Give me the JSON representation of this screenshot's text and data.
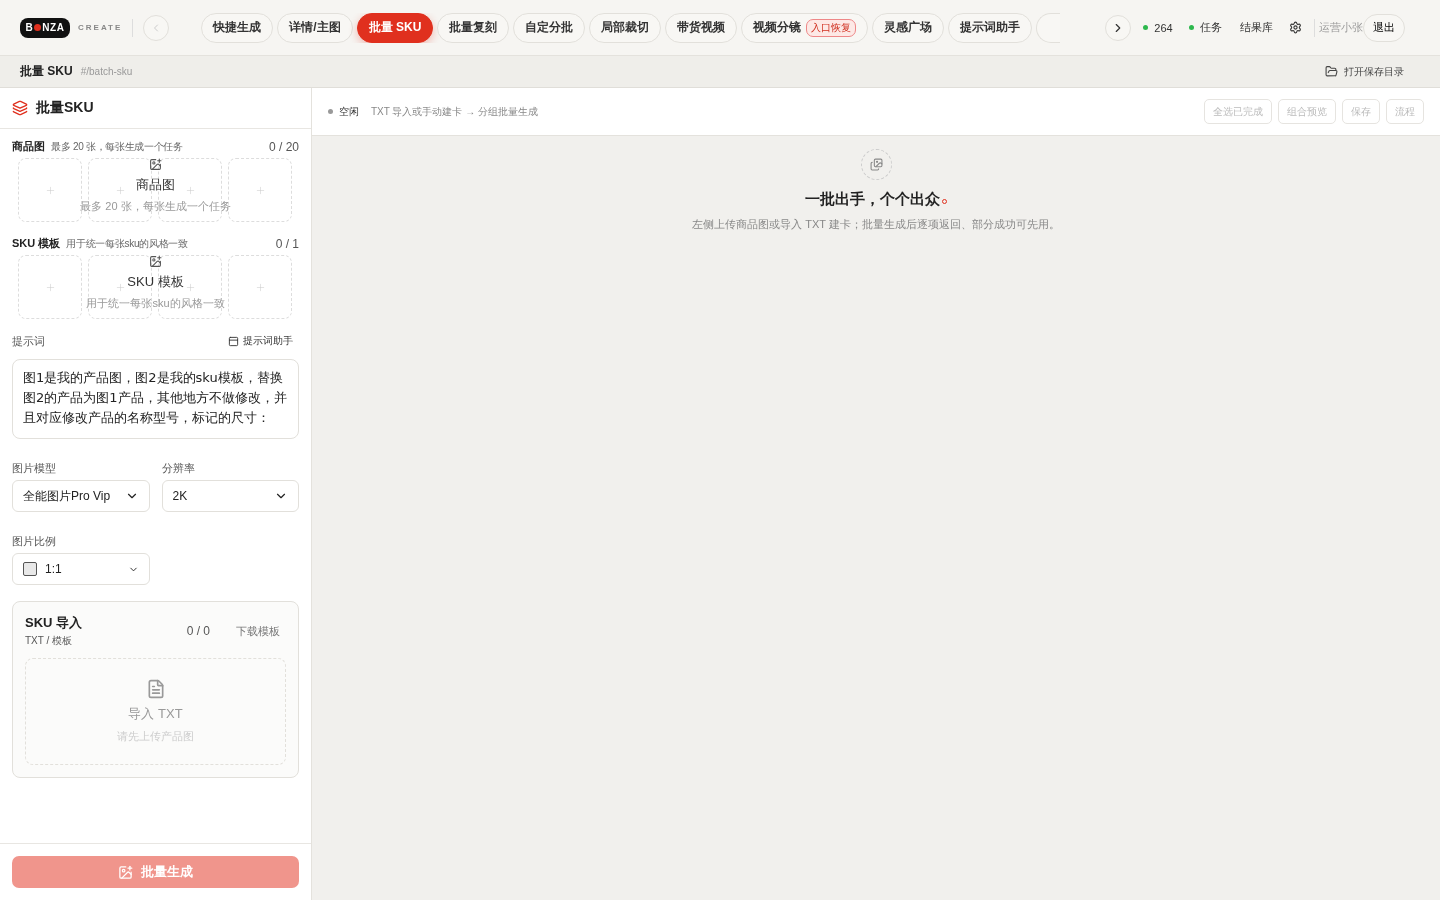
{
  "logo": {
    "left": "B",
    "right": "NZA",
    "tag": "CREATE"
  },
  "tabs": [
    {
      "label": "快捷生成",
      "selected": false
    },
    {
      "label": "详情/主图",
      "selected": false
    },
    {
      "label": "批量 SKU",
      "selected": true
    },
    {
      "label": "批量复刻",
      "selected": false
    },
    {
      "label": "自定分批",
      "selected": false
    },
    {
      "label": "局部裁切",
      "selected": false
    },
    {
      "label": "带货视频",
      "selected": false
    },
    {
      "label": "视频分镜",
      "selected": false,
      "badge": "入口恢复"
    },
    {
      "label": "灵感广场",
      "selected": false
    },
    {
      "label": "提示词助手",
      "selected": false
    }
  ],
  "top_right": {
    "credits": "264",
    "tasks": "任务",
    "results": "结果库",
    "user": "运营小张",
    "logout": "退出"
  },
  "breadcrumb": {
    "title": "批量 SKU",
    "path": "#/batch-sku",
    "open_folder": "打开保存目录"
  },
  "panel": {
    "title": "批量SKU",
    "uploads": [
      {
        "label": "商品图",
        "hint": "最多 20 张，每张生成一个任务",
        "count": "0 / 20",
        "overlay_label": "商品图",
        "overlay_hint": "最多 20 张，每张生成一个任务"
      },
      {
        "label": "SKU 模板",
        "hint": "用于统一每张sku的风格一致",
        "count": "0 / 1",
        "overlay_label": "SKU 模板",
        "overlay_hint": "用于统一每张sku的风格一致"
      }
    ],
    "prompt": {
      "label": "提示词",
      "assistant": "提示词助手",
      "value": "图1是我的产品图，图2是我的sku模板，替换图2的产品为图1产品，其他地方不做修改，并且对应修改产品的名称型号，标记的尺寸："
    },
    "model": {
      "label": "图片模型",
      "value": "全能图片Pro Vip"
    },
    "resolution": {
      "label": "分辨率",
      "value": "2K"
    },
    "ratio": {
      "label": "图片比例",
      "value": "1:1"
    },
    "sku_import": {
      "title": "SKU 导入",
      "subtitle": "TXT / 模板",
      "count": "0 / 0",
      "download": "下载模板",
      "drop_title": "导入 TXT",
      "drop_hint": "请先上传产品图"
    },
    "generate": {
      "label": "批量生成",
      "disabled": true
    }
  },
  "toolbar": {
    "status": "空闲",
    "flow": "TXT 导入或手动建卡 → 分组批量生成",
    "buttons": [
      {
        "label": "全选已完成",
        "disabled": true
      },
      {
        "label": "组合预览",
        "disabled": true
      },
      {
        "label": "保存",
        "disabled": true
      },
      {
        "label": "流程",
        "disabled": true
      }
    ]
  },
  "empty": {
    "title": "一批出手，个个出众",
    "hint": "左侧上传商品图或导入 TXT 建卡；批量生成后逐项返回、部分成功可先用。"
  }
}
